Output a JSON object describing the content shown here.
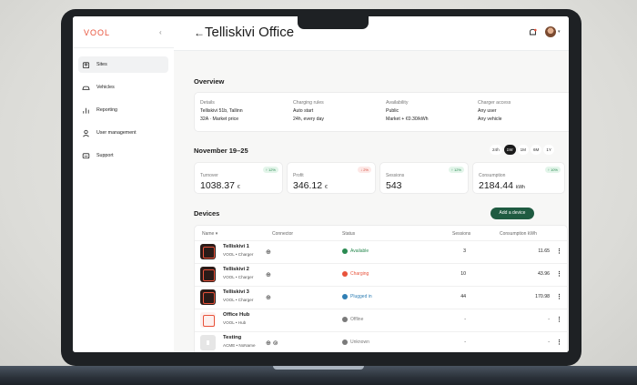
{
  "app": {
    "logo": "VOOL",
    "collapse_icon": "chevron-left-icon"
  },
  "sidebar": {
    "items": [
      {
        "label": "Sites",
        "icon": "sites-icon",
        "active": true
      },
      {
        "label": "Vehicles",
        "icon": "car-icon"
      },
      {
        "label": "Reporting",
        "icon": "bar-chart-icon"
      },
      {
        "label": "User management",
        "icon": "user-icon"
      },
      {
        "label": "Support",
        "icon": "chat-icon"
      }
    ]
  },
  "header": {
    "back": "←",
    "title": "Telliskivi Office"
  },
  "overview": {
    "heading": "Overview",
    "columns": [
      {
        "label": "Details",
        "line1": "Telliskivi 51b, Tallinn",
        "line2": "32A · Market price"
      },
      {
        "label": "Charging rules",
        "line1": "Auto start",
        "line2": "24h, every day"
      },
      {
        "label": "Availability",
        "line1": "Public",
        "line2": "Market + €0.30/kWh"
      },
      {
        "label": "Charger access",
        "line1": "Any user",
        "line2": "Any vehicle"
      }
    ]
  },
  "period": {
    "heading": "November 19–25",
    "ranges": [
      "24h",
      "1W",
      "1M",
      "6M",
      "1Y"
    ],
    "selected": "1W"
  },
  "stats": [
    {
      "label": "Turnover",
      "value": "1038.37",
      "unit": "€",
      "badge": "↑ 12%",
      "trend": "up"
    },
    {
      "label": "Profit",
      "value": "346.12",
      "unit": "€",
      "badge": "↓ 2%",
      "trend": "down"
    },
    {
      "label": "Sessions",
      "value": "543",
      "unit": "",
      "badge": "↑ 12%",
      "trend": "up"
    },
    {
      "label": "Consumption",
      "value": "2184.44",
      "unit": "kWh",
      "badge": "↑ 10%",
      "trend": "up"
    }
  ],
  "devices": {
    "heading": "Devices",
    "add_label": "Add a device",
    "columns": {
      "name": "Name ▾",
      "connector": "Connector",
      "status": "Status",
      "sessions": "Sessions",
      "consumption": "Consumption kWh"
    },
    "rows": [
      {
        "name": "Telliskivi 1",
        "sub": "VOOL • Charger",
        "icon": "dark",
        "connectors": "⊕",
        "status": "Available",
        "status_color": "#2a8a51",
        "sessions": "3",
        "consumption": "11.65"
      },
      {
        "name": "Telliskivi 2",
        "sub": "VOOL • Charger",
        "icon": "dark",
        "connectors": "⊕",
        "status": "Charging",
        "status_color": "#e8533b",
        "sessions": "10",
        "consumption": "43.96"
      },
      {
        "name": "Telliskivi 3",
        "sub": "VOOL • Charger",
        "icon": "dark",
        "connectors": "⊕",
        "status": "Plugged in",
        "status_color": "#2f7fb4",
        "sessions": "44",
        "consumption": "170.98"
      },
      {
        "name": "Office Hub",
        "sub": "VOOL • Hub",
        "icon": "light",
        "connectors": "",
        "status": "Offline",
        "status_color": "#7a7a7a",
        "sessions": "-",
        "consumption": "-"
      },
      {
        "name": "Testing",
        "sub": "ACME • NoName",
        "icon": "grey",
        "connectors": "⊕ ⊚",
        "status": "Unknown",
        "status_color": "#7a7a7a",
        "sessions": "-",
        "consumption": "-"
      }
    ]
  }
}
